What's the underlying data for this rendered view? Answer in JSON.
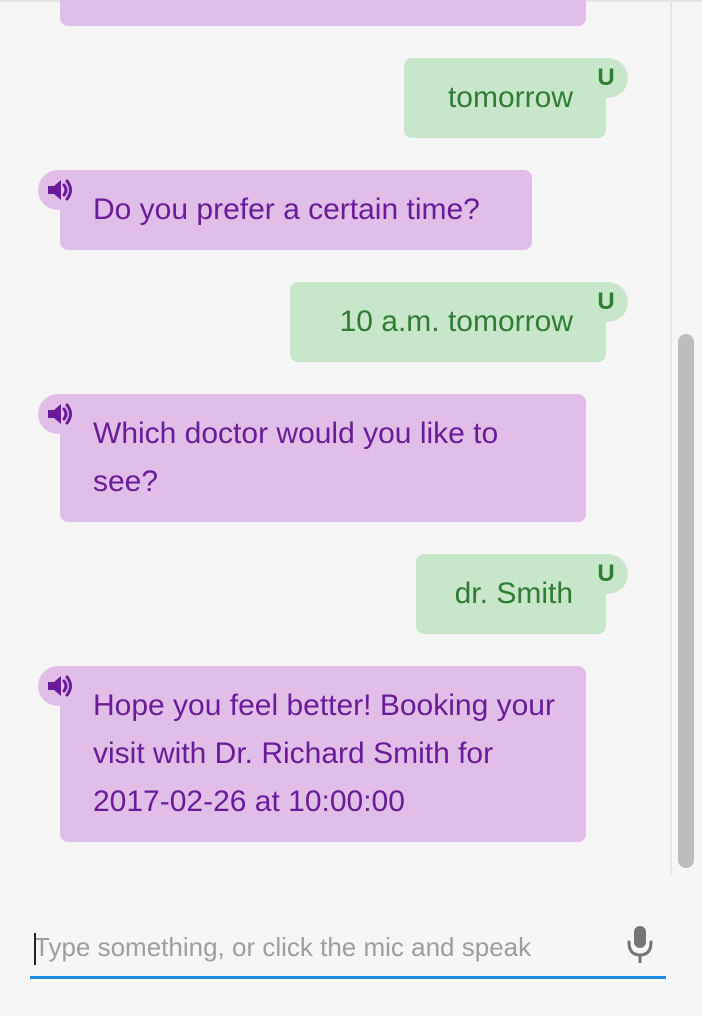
{
  "colors": {
    "bot_bubble": "#e1bee7",
    "bot_text": "#6a1b9a",
    "user_bubble": "#c8e6c9",
    "user_text": "#2e7d32",
    "input_underline": "#1e88e5"
  },
  "messages": [
    {
      "sender": "bot",
      "text": "",
      "icon": "speaker-icon"
    },
    {
      "sender": "user",
      "text": "tomorrow",
      "badge": "U"
    },
    {
      "sender": "bot",
      "text": "Do you prefer a certain time?",
      "icon": "speaker-icon"
    },
    {
      "sender": "user",
      "text": "10 a.m. tomorrow",
      "badge": "U"
    },
    {
      "sender": "bot",
      "text": "Which doctor would you like to see?",
      "icon": "speaker-icon"
    },
    {
      "sender": "user",
      "text": "dr. Smith",
      "badge": "U"
    },
    {
      "sender": "bot",
      "text": "Hope you feel better! Booking your visit with Dr. Richard Smith for 2017-02-26 at 10:00:00",
      "icon": "speaker-icon"
    }
  ],
  "composer": {
    "value": "",
    "placeholder": "Type something, or click the mic and speak",
    "mic_icon": "microphone-icon"
  }
}
